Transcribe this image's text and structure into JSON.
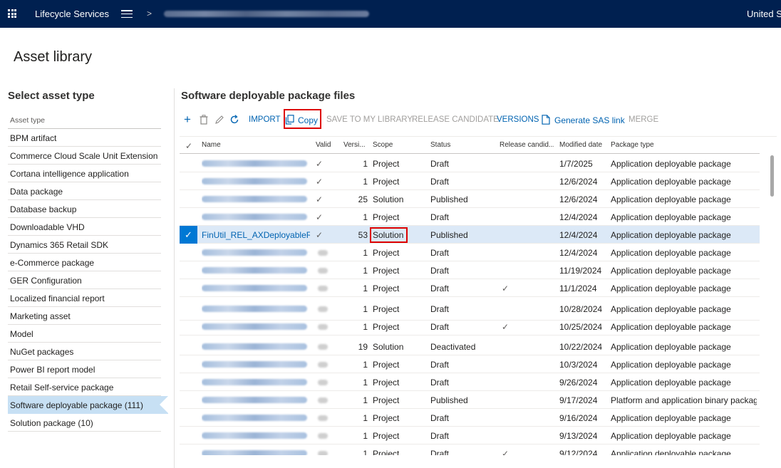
{
  "topbar": {
    "app_name": "Lifecycle Services",
    "breadcrumb_separator": ">",
    "region": "United S"
  },
  "page": {
    "title": "Asset library"
  },
  "left_panel": {
    "title": "Select asset type",
    "column_header": "Asset type",
    "items": [
      "BPM artifact",
      "Commerce Cloud Scale Unit Extension",
      "Cortana intelligence application",
      "Data package",
      "Database backup",
      "Downloadable VHD",
      "Dynamics 365 Retail SDK",
      "e-Commerce package",
      "GER Configuration",
      "Localized financial report",
      "Marketing asset",
      "Model",
      "NuGet packages",
      "Power BI report model",
      "Retail Self-service package",
      "Software deployable package (111)",
      "Solution package (10)"
    ],
    "selected_index": 15
  },
  "right_panel": {
    "title": "Software deployable package files",
    "toolbar": {
      "import": "IMPORT",
      "copy": "Copy",
      "save_to_library": "SAVE TO MY LIBRARY",
      "release_candidate": "RELEASE CANDIDATE",
      "versions": "VERSIONS",
      "generate_sas": "Generate SAS link",
      "merge": "MERGE"
    },
    "columns": {
      "name": "Name",
      "valid": "Valid",
      "version": "Versi...",
      "scope": "Scope",
      "status": "Status",
      "release_candidate": "Release candid...",
      "modified": "Modified date",
      "package_type": "Package type"
    },
    "rows": [
      {
        "name": "",
        "valid": "✓",
        "version": "1",
        "scope": "Project",
        "status": "Draft",
        "rc": "",
        "modified": "1/7/2025",
        "type": "Application deployable package"
      },
      {
        "name": "",
        "valid": "✓",
        "version": "1",
        "scope": "Project",
        "status": "Draft",
        "rc": "",
        "modified": "12/6/2024",
        "type": "Application deployable package"
      },
      {
        "name": "",
        "valid": "✓",
        "version": "25",
        "scope": "Solution",
        "status": "Published",
        "rc": "",
        "modified": "12/6/2024",
        "type": "Application deployable package"
      },
      {
        "name": "",
        "valid": "✓",
        "version": "1",
        "scope": "Project",
        "status": "Draft",
        "rc": "",
        "modified": "12/4/2024",
        "type": "Application deployable package"
      },
      {
        "name": "FinUtil_REL_AXDeployableRu...",
        "valid": "✓",
        "version": "53",
        "scope": "Solution",
        "status": "Published",
        "rc": "",
        "modified": "12/4/2024",
        "type": "Application deployable package"
      },
      {
        "name": "",
        "valid": "",
        "version": "1",
        "scope": "Project",
        "status": "Draft",
        "rc": "",
        "modified": "12/4/2024",
        "type": "Application deployable package"
      },
      {
        "name": "",
        "valid": "",
        "version": "1",
        "scope": "Project",
        "status": "Draft",
        "rc": "",
        "modified": "11/19/2024",
        "type": "Application deployable package"
      },
      {
        "name": "",
        "valid": "",
        "version": "1",
        "scope": "Project",
        "status": "Draft",
        "rc": "✓",
        "modified": "11/1/2024",
        "type": "Application deployable package"
      },
      {
        "name": "",
        "valid": "",
        "version": "1",
        "scope": "Project",
        "status": "Draft",
        "rc": "",
        "modified": "10/28/2024",
        "type": "Application deployable package"
      },
      {
        "name": "",
        "valid": "",
        "version": "1",
        "scope": "Project",
        "status": "Draft",
        "rc": "✓",
        "modified": "10/25/2024",
        "type": "Application deployable package"
      },
      {
        "name": "",
        "valid": "",
        "version": "19",
        "scope": "Solution",
        "status": "Deactivated",
        "rc": "",
        "modified": "10/22/2024",
        "type": "Application deployable package"
      },
      {
        "name": "",
        "valid": "",
        "version": "1",
        "scope": "Project",
        "status": "Draft",
        "rc": "",
        "modified": "10/3/2024",
        "type": "Application deployable package"
      },
      {
        "name": "",
        "valid": "",
        "version": "1",
        "scope": "Project",
        "status": "Draft",
        "rc": "",
        "modified": "9/26/2024",
        "type": "Application deployable package"
      },
      {
        "name": "",
        "valid": "",
        "version": "1",
        "scope": "Project",
        "status": "Published",
        "rc": "",
        "modified": "9/17/2024",
        "type": "Platform and application binary package"
      },
      {
        "name": "",
        "valid": "",
        "version": "1",
        "scope": "Project",
        "status": "Draft",
        "rc": "",
        "modified": "9/16/2024",
        "type": "Application deployable package"
      },
      {
        "name": "",
        "valid": "",
        "version": "1",
        "scope": "Project",
        "status": "Draft",
        "rc": "",
        "modified": "9/13/2024",
        "type": "Application deployable package"
      },
      {
        "name": "",
        "valid": "",
        "version": "1",
        "scope": "Project",
        "status": "Draft",
        "rc": "✓",
        "modified": "9/12/2024",
        "type": "Application deployable package"
      }
    ],
    "selected_row": 4
  }
}
